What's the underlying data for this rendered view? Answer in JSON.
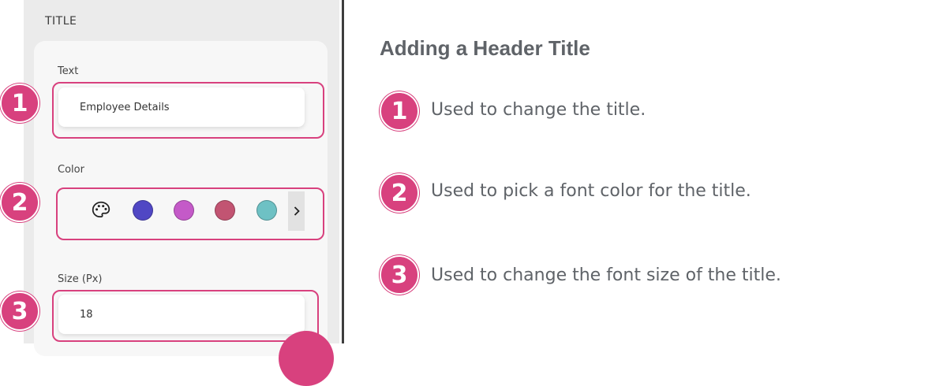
{
  "panel": {
    "section_title": "TITLE",
    "text_field": {
      "label": "Text",
      "value": "Employee Details"
    },
    "color_field": {
      "label": "Color",
      "swatches": [
        "#5047c4",
        "#c45ac8",
        "#c25472",
        "#6ec1c4"
      ],
      "palette_icon": "palette-icon",
      "next_icon": "chevron-right-icon"
    },
    "size_field": {
      "label": "Size (Px)",
      "value": "18"
    }
  },
  "callouts": {
    "heading": "Adding a Header Title",
    "items": [
      {
        "number": "1",
        "text": "Used to change the title."
      },
      {
        "number": "2",
        "text": "Used to pick a font color for the title."
      },
      {
        "number": "3",
        "text": "Used to change the font size of the title."
      }
    ]
  },
  "colors": {
    "accent": "#d8417e",
    "text": "#5f6368",
    "panel": "#ebebeb"
  }
}
